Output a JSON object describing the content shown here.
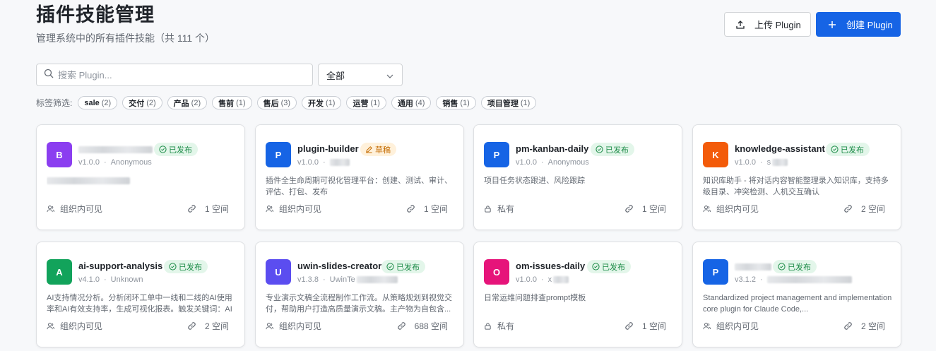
{
  "header": {
    "title": "插件技能管理",
    "subtitle": "管理系统中的所有插件技能（共 111 个）"
  },
  "toolbar": {
    "upload_label": "上传 Plugin",
    "create_label": "创建 Plugin"
  },
  "search": {
    "placeholder": "搜索 Plugin..."
  },
  "filter": {
    "selected": "全部"
  },
  "tag_filter": {
    "label": "标签筛选:",
    "tags": [
      {
        "name": "sale",
        "count": "(2)"
      },
      {
        "name": "交付",
        "count": "(2)"
      },
      {
        "name": "产品",
        "count": "(2)"
      },
      {
        "name": "售前",
        "count": "(1)"
      },
      {
        "name": "售后",
        "count": "(3)"
      },
      {
        "name": "开发",
        "count": "(1)"
      },
      {
        "name": "运营",
        "count": "(1)"
      },
      {
        "name": "通用",
        "count": "(4)"
      },
      {
        "name": "销售",
        "count": "(1)"
      },
      {
        "name": "项目管理",
        "count": "(1)"
      }
    ]
  },
  "colors": {
    "accent": "#1664e5",
    "published": "#1a8a45",
    "draft": "#c46b00"
  },
  "cards": [
    {
      "initial": "B",
      "color": "#8b3ef0",
      "name": "",
      "status": "已发布",
      "status_type": "published",
      "version": "v1.0.0",
      "author": "Anonymous",
      "desc": "",
      "visibility": "组织内可见",
      "visibility_icon": "user-icon",
      "spaces": "1 空间"
    },
    {
      "initial": "P",
      "color": "#1664e5",
      "name": "plugin-builder",
      "status": "草稿",
      "status_type": "draft",
      "version": "v1.0.0",
      "author": "",
      "desc": "插件全生命周期可视化管理平台：创建、测试、审计、评估、打包、发布",
      "visibility": "组织内可见",
      "visibility_icon": "user-icon",
      "spaces": "1 空间"
    },
    {
      "initial": "P",
      "color": "#1664e5",
      "name": "pm-kanban-daily",
      "status": "已发布",
      "status_type": "published",
      "version": "v1.0.0",
      "author": "Anonymous",
      "desc": "项目任务状态跟进、风险跟踪",
      "visibility": "私有",
      "visibility_icon": "lock-icon",
      "spaces": "1 空间"
    },
    {
      "initial": "K",
      "color": "#f35b0a",
      "name": "knowledge-assistant",
      "status": "已发布",
      "status_type": "published",
      "version": "v1.0.0",
      "author": "s",
      "desc": "知识库助手 - 将对话内容智能整理录入知识库，支持多级目录、冲突检测、人机交互确认",
      "visibility": "组织内可见",
      "visibility_icon": "user-icon",
      "spaces": "2 空间"
    },
    {
      "initial": "A",
      "color": "#12a35b",
      "name": "ai-support-analysis",
      "status": "已发布",
      "status_type": "published",
      "version": "v4.1.0",
      "author": "Unknown",
      "desc": "AI支持情况分析。分析闭环工单中一线和二线的AI使用率和AI有效支持率，生成可视化报表。触发关键词：AI分...",
      "visibility": "组织内可见",
      "visibility_icon": "user-icon",
      "spaces": "2 空间"
    },
    {
      "initial": "U",
      "color": "#5b4df0",
      "name": "uwin-slides-creator",
      "status": "已发布",
      "status_type": "published",
      "version": "v1.3.8",
      "author": "UwinTe",
      "desc": "专业演示文稿全流程制作工作流。从策略规划到视觉交付，帮助用户打造高质量演示文稿。主产物为自包含...",
      "visibility": "组织内可见",
      "visibility_icon": "user-icon",
      "spaces": "688 空间"
    },
    {
      "initial": "O",
      "color": "#e6147a",
      "name": "om-issues-daily",
      "status": "已发布",
      "status_type": "published",
      "version": "v1.0.0",
      "author": "x",
      "desc": "日常运维问题排查prompt模板",
      "visibility": "私有",
      "visibility_icon": "lock-icon",
      "spaces": "1 空间"
    },
    {
      "initial": "P",
      "color": "#1664e5",
      "name": "",
      "status": "已发布",
      "status_type": "published",
      "version": "v3.1.2",
      "author": "",
      "desc": "Standardized project management and implementation core plugin for Claude Code,...",
      "visibility": "组织内可见",
      "visibility_icon": "user-icon",
      "spaces": "2 空间"
    }
  ]
}
